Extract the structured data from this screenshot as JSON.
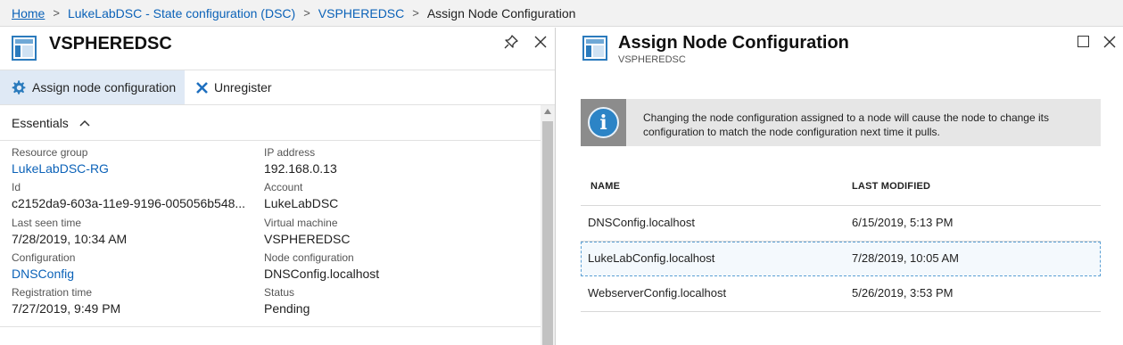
{
  "breadcrumb": {
    "items": [
      "Home",
      "LukeLabDSC - State configuration (DSC)",
      "VSPHEREDSC"
    ],
    "current": "Assign Node Configuration",
    "separator": ">"
  },
  "left_blade": {
    "title": "VSPHEREDSC",
    "toolbar": {
      "assign_label": "Assign node configuration",
      "unregister_label": "Unregister"
    },
    "essentials_label": "Essentials",
    "essentials_left": [
      {
        "label": "Resource group",
        "value": "LukeLabDSC-RG"
      },
      {
        "label": "Id",
        "value": "c2152da9-603a-11e9-9196-005056b548..."
      },
      {
        "label": "Last seen time",
        "value": "7/28/2019, 10:34 AM"
      },
      {
        "label": "Configuration",
        "value": "DNSConfig"
      },
      {
        "label": "Registration time",
        "value": "7/27/2019, 9:49 PM"
      }
    ],
    "essentials_right": [
      {
        "label": "IP address",
        "value": "192.168.0.13"
      },
      {
        "label": "Account",
        "value": "LukeLabDSC"
      },
      {
        "label": "Virtual machine",
        "value": "VSPHEREDSC"
      },
      {
        "label": "Node configuration",
        "value": "DNSConfig.localhost"
      },
      {
        "label": "Status",
        "value": "Pending"
      }
    ]
  },
  "right_blade": {
    "title": "Assign Node Configuration",
    "subtitle": "VSPHEREDSC",
    "info_text": "Changing the node configuration assigned to a node will cause the node to change its configuration to match the node configuration next time it pulls.",
    "table": {
      "headers": [
        "NAME",
        "LAST MODIFIED"
      ],
      "rows": [
        {
          "name": "DNSConfig.localhost",
          "modified": "6/15/2019, 5:13 PM"
        },
        {
          "name": "LukeLabConfig.localhost",
          "modified": "7/28/2019, 10:05 AM"
        },
        {
          "name": "WebserverConfig.localhost",
          "modified": "5/26/2019, 3:53 PM"
        }
      ]
    }
  },
  "colors": {
    "link": "#0b62b8",
    "accent": "#2b7bbd",
    "toolbar_active": "#dfe9f5",
    "info_bg": "#e6e6e6"
  }
}
